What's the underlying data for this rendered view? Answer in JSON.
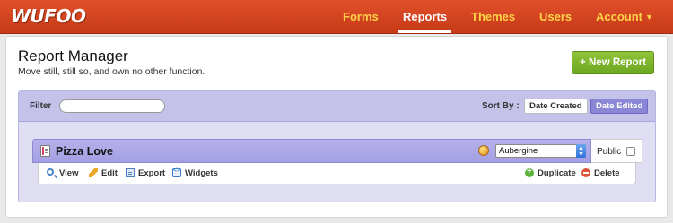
{
  "app": {
    "logo": "WUFOO"
  },
  "nav": {
    "forms": "Forms",
    "reports": "Reports",
    "themes": "Themes",
    "users": "Users",
    "account": "Account",
    "active": "Reports"
  },
  "page": {
    "title": "Report Manager",
    "subtitle": "Move still, still so, and own no other function.",
    "new_button": "+ New Report"
  },
  "filter": {
    "label": "Filter",
    "value": "",
    "placeholder": "",
    "sort_label": "Sort By :",
    "sort_options": [
      "Date Created",
      "Date Edited"
    ],
    "sort_selected": "Date Edited"
  },
  "reports": [
    {
      "name": "Pizza Love",
      "theme": "Aubergine",
      "public_label": "Public",
      "public": false,
      "actions": {
        "view": "View",
        "edit": "Edit",
        "export": "Export",
        "widgets": "Widgets",
        "duplicate": "Duplicate",
        "delete": "Delete"
      }
    }
  ],
  "colors": {
    "topbar": "#d2441f",
    "nav_inactive": "#ffd24a",
    "accent_purple": "#8c86d6",
    "new_button": "#7bb52c"
  }
}
